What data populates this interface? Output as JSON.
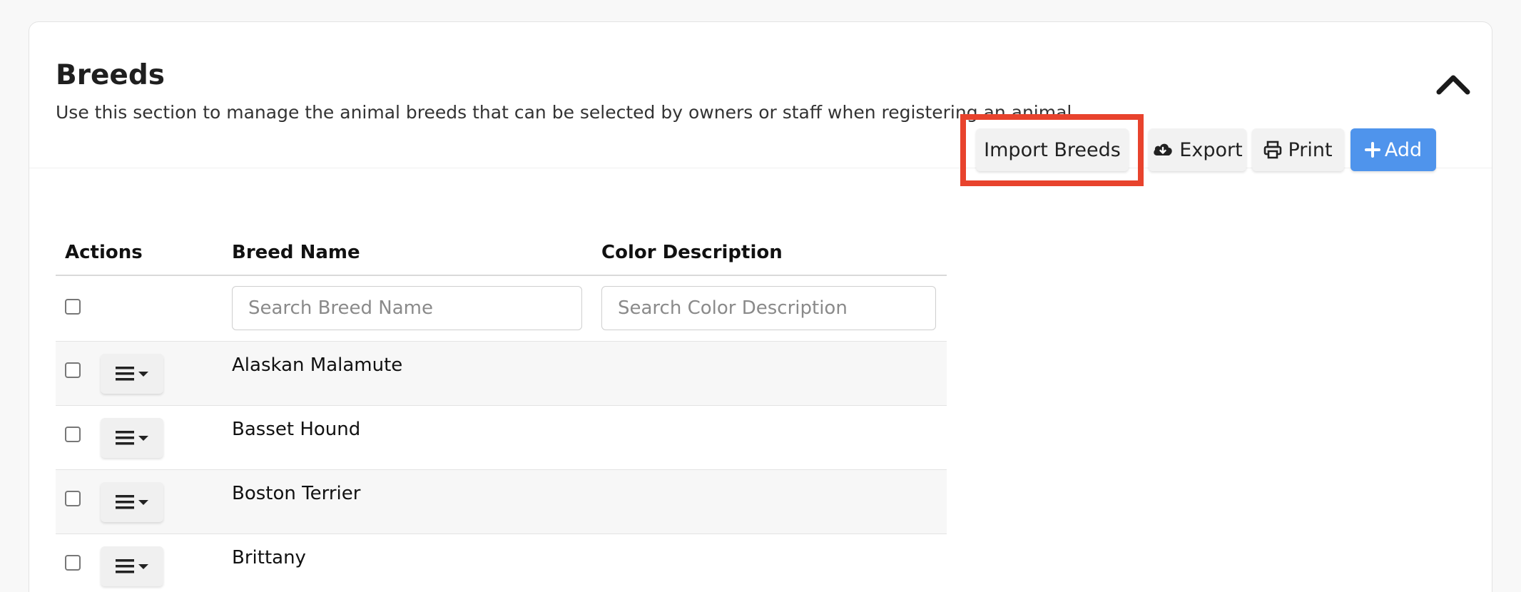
{
  "section": {
    "title": "Breeds",
    "description": "Use this section to manage the animal breeds that can be selected by owners or staff when registering an animal."
  },
  "toolbar": {
    "import_label": "Import Breeds",
    "export_label": "Export",
    "print_label": "Print",
    "add_label": "Add"
  },
  "table": {
    "headers": {
      "actions": "Actions",
      "breed_name": "Breed Name",
      "color_description": "Color Description"
    },
    "filters": {
      "breed_placeholder": "Search Breed Name",
      "color_placeholder": "Search Color Description"
    },
    "rows": [
      {
        "breed_name": "Alaskan Malamute",
        "color_description": ""
      },
      {
        "breed_name": "Basset Hound",
        "color_description": ""
      },
      {
        "breed_name": "Boston Terrier",
        "color_description": ""
      },
      {
        "breed_name": "Brittany",
        "color_description": ""
      }
    ]
  },
  "colors": {
    "accent": "#4f94ec",
    "highlight": "#e8432d"
  },
  "icons": {
    "collapse": "chevron-up-icon",
    "export": "cloud-download-icon",
    "print": "printer-icon",
    "add": "plus-icon",
    "row_menu": "hamburger-menu-icon"
  }
}
